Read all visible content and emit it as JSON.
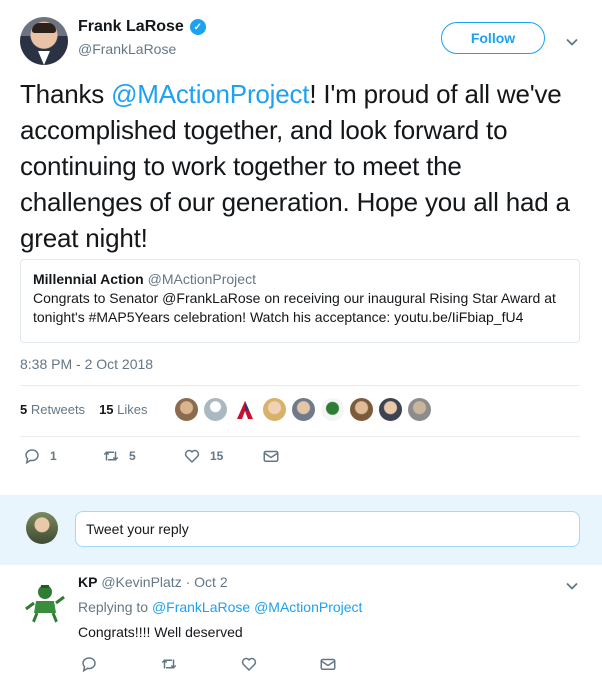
{
  "tweet": {
    "author_name": "Frank LaRose",
    "author_handle": "@FrankLaRose",
    "verified_icon": "verified-badge-icon",
    "follow_label": "Follow",
    "text_before": "Thanks ",
    "text_mention": "@MActionProject",
    "text_after": "! I'm proud of all we've accomplished together, and look forward to continuing to work together to meet the challenges of our generation. Hope you all had a great night!",
    "quote": {
      "name": "Millennial Action",
      "handle": "@MActionProject",
      "text": "Congrats to Senator @FrankLaRose on receiving our inaugural Rising Star Award at tonight's #MAP5Years celebration! Watch his acceptance: youtu.be/IiFbiap_fU4"
    },
    "timestamp": "8:38 PM - 2 Oct 2018",
    "retweets_count": "5",
    "retweets_label": "Retweets",
    "likes_count": "15",
    "likes_label": "Likes",
    "actions": {
      "reply_count": "1",
      "retweet_count": "5",
      "like_count": "15"
    }
  },
  "reply_composer": {
    "placeholder": "Tweet your reply"
  },
  "reply": {
    "name": "KP",
    "handle": "@KevinPlatz",
    "date": "· Oct 2",
    "replying_prefix": "Replying to",
    "replying_to": "@FrankLaRose @MActionProject",
    "text": "Congrats!!!! Well deserved"
  },
  "colors": {
    "accent": "#1da1f2",
    "secondary_text": "#657786",
    "reply_bar_bg": "#e8f5fd"
  }
}
